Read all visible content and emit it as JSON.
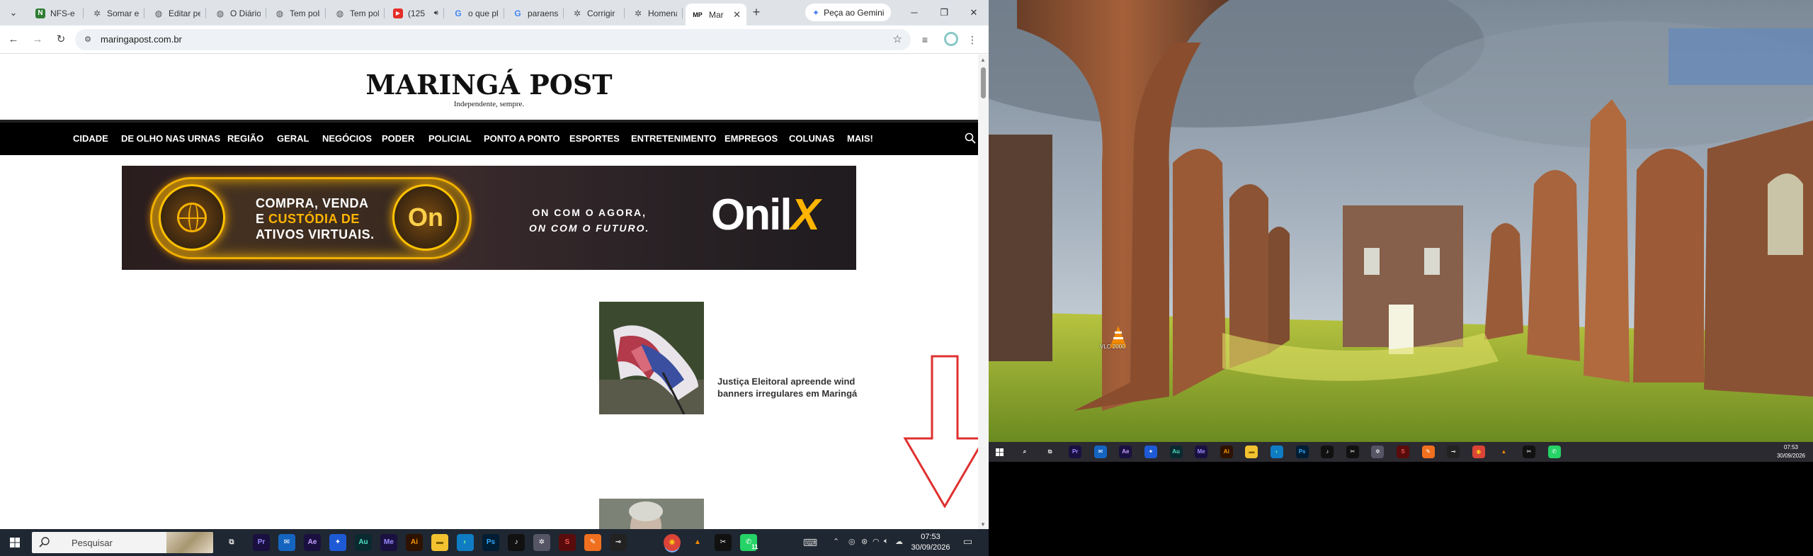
{
  "browser": {
    "tabs": [
      {
        "title": "NFS-e | I",
        "icon": "n-green",
        "color": "#2f7d32"
      },
      {
        "title": "Somar e",
        "icon": "gear",
        "color": "#555555"
      },
      {
        "title": "Editar pe",
        "icon": "globe",
        "color": "#555555"
      },
      {
        "title": "O Diário",
        "icon": "globe",
        "color": "#555555"
      },
      {
        "title": "Tem poli",
        "icon": "globe",
        "color": "#555555"
      },
      {
        "title": "Tem poli",
        "icon": "globe",
        "color": "#555555"
      },
      {
        "title": "(125",
        "icon": "youtube",
        "color": "#e52d27"
      },
      {
        "title": "o que pl",
        "icon": "google",
        "color": "#4285f4"
      },
      {
        "title": "paraens",
        "icon": "google",
        "color": "#4285f4"
      },
      {
        "title": "Corrigir",
        "icon": "gear",
        "color": "#555555"
      },
      {
        "title": "Homena",
        "icon": "gear",
        "color": "#555555"
      },
      {
        "title": "Mar",
        "icon": "mp",
        "color": "#111111"
      }
    ],
    "gemini_label": "Peça ao Gemini",
    "url": "maringapost.com.br"
  },
  "site": {
    "logo": "MARINGÁ POST",
    "slogan": "Independente, sempre.",
    "nav": [
      "CIDADE",
      "DE OLHO NAS URNAS",
      "REGIÃO",
      "GERAL",
      "NEGÓCIOS",
      "PODER",
      "POLICIAL",
      "PONTO A PONTO",
      "ESPORTES",
      "ENTRETENIMENTO",
      "EMPREGOS",
      "COLUNAS",
      "MAIS!"
    ],
    "banner": {
      "line1": "COMPRA, VENDA",
      "line2a": "E ",
      "line2b": "CUSTÓDIA DE",
      "line3": "ATIVOS VIRTUAIS.",
      "coin": "On",
      "slogan1": "ON COM O AGORA,",
      "slogan2": "ON COM O FUTURO.",
      "brand1": "Onil",
      "brand2": "X"
    },
    "news": [
      {
        "title": "Justiça Eleitoral apreende wind banners irregulares em Maringá"
      }
    ]
  },
  "taskbar_left": {
    "search_placeholder": "Pesquisar",
    "time": "07:53",
    "date": "30/09/2026",
    "whatsapp_badge": "11"
  },
  "desktop": {
    "vlc_label": "VLC 2000",
    "time": "07:53",
    "date": "30/09/2026"
  },
  "colors": {
    "accent_red": "#d32f2f",
    "banner_gold": "#ffb400",
    "navbar": "#000000"
  }
}
